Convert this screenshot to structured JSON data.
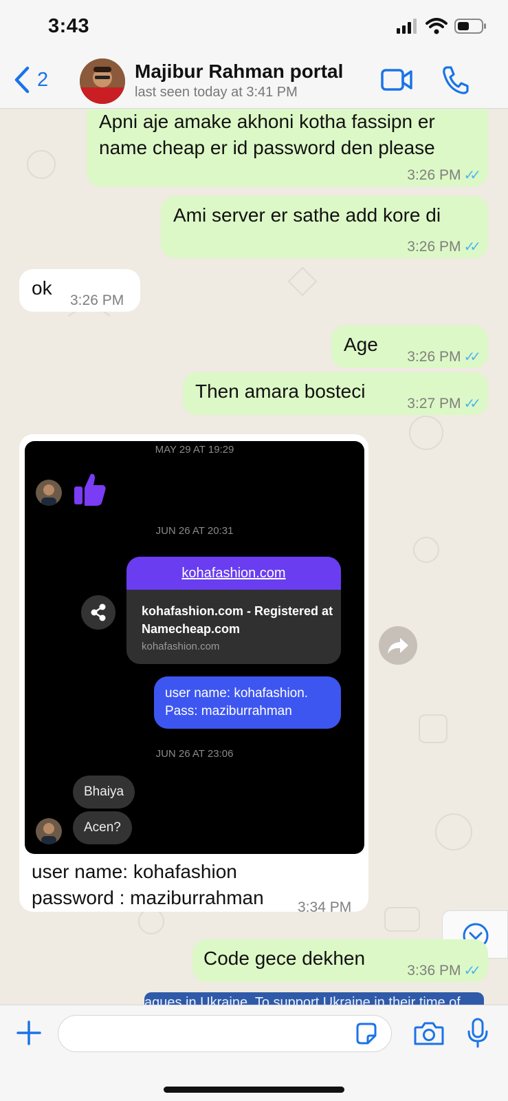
{
  "status_bar": {
    "time": "3:43"
  },
  "header": {
    "back_count": "2",
    "contact_name": "Majibur Rahman portal",
    "last_seen": "last seen today at 3:41 PM"
  },
  "messages": [
    {
      "type": "out",
      "text_line1": "Apni aje amake akhoni kotha fassipn er",
      "text_line2": "name cheap er id password den please",
      "time": "3:26 PM",
      "status": "read"
    },
    {
      "type": "out",
      "text": "Ami server er sathe add kore di",
      "time": "3:26 PM",
      "status": "read"
    },
    {
      "type": "in",
      "text": "ok",
      "time": "3:26 PM"
    },
    {
      "type": "out",
      "text": "Age",
      "time": "3:26 PM",
      "status": "read"
    },
    {
      "type": "out",
      "text": "Then amara bosteci",
      "time": "3:27 PM",
      "status": "read"
    },
    {
      "type": "in-image",
      "caption_line1": "user name: kohafashion",
      "caption_line2": "password : maziburrahman",
      "time": "3:34 PM",
      "screenshot": {
        "date1": "MAY 29 AT 19:29",
        "date2": "JUN 26 AT 20:31",
        "link_url": "kohafashion.com",
        "link_title": "kohafashion.com - Registered at Namecheap.com",
        "link_domain": "kohafashion.com",
        "creds_line1": "user name: kohafashion.",
        "creds_line2": "Pass: maziburrahman",
        "date3": "JUN 26 AT 23:06",
        "bubble1": "Bhaiya",
        "bubble2": "Acen?"
      }
    },
    {
      "type": "out",
      "text": "Code gece dekhen",
      "time": "3:36 PM",
      "status": "read"
    }
  ],
  "partial_banner": "agues in Ukraine. To support Ukraine in their time of",
  "input": {
    "placeholder": ""
  },
  "colors": {
    "accent": "#1a73e8",
    "outgoing": "#dcf8c6",
    "incoming": "#ffffff",
    "ticks": "#4fb6ec"
  }
}
